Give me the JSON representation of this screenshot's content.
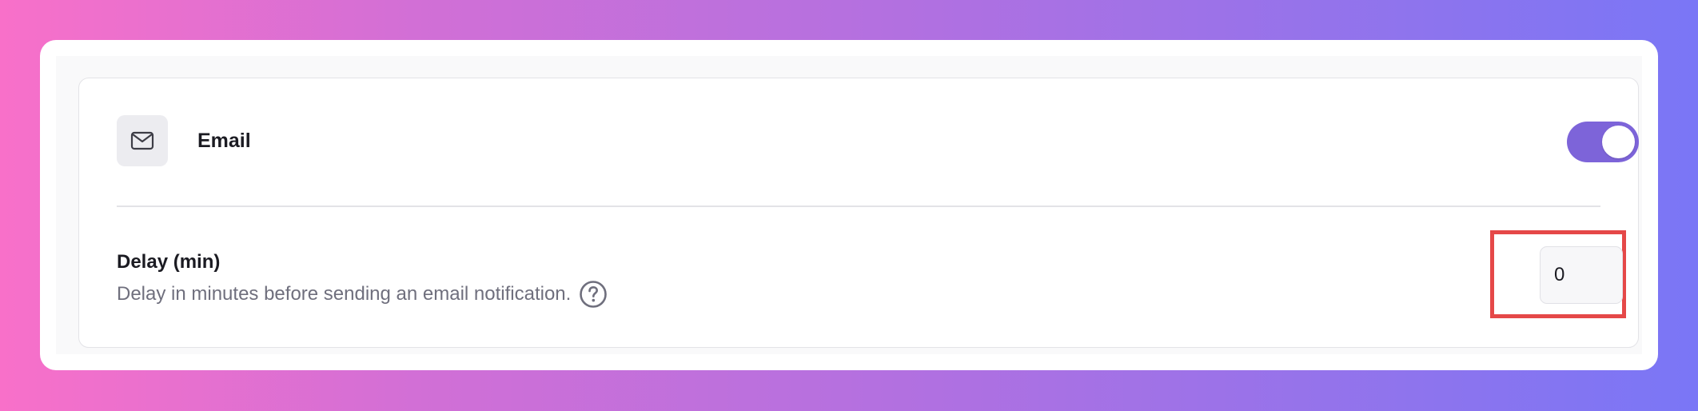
{
  "channel": {
    "label": "Email",
    "icon": "mail-icon",
    "enabled": true,
    "accent_color": "#7d64d9"
  },
  "delay_setting": {
    "title": "Delay (min)",
    "description": "Delay in minutes before sending an email notification.",
    "help_icon": "question-circle-icon",
    "value": "0",
    "highlight_color": "#e54848"
  }
}
